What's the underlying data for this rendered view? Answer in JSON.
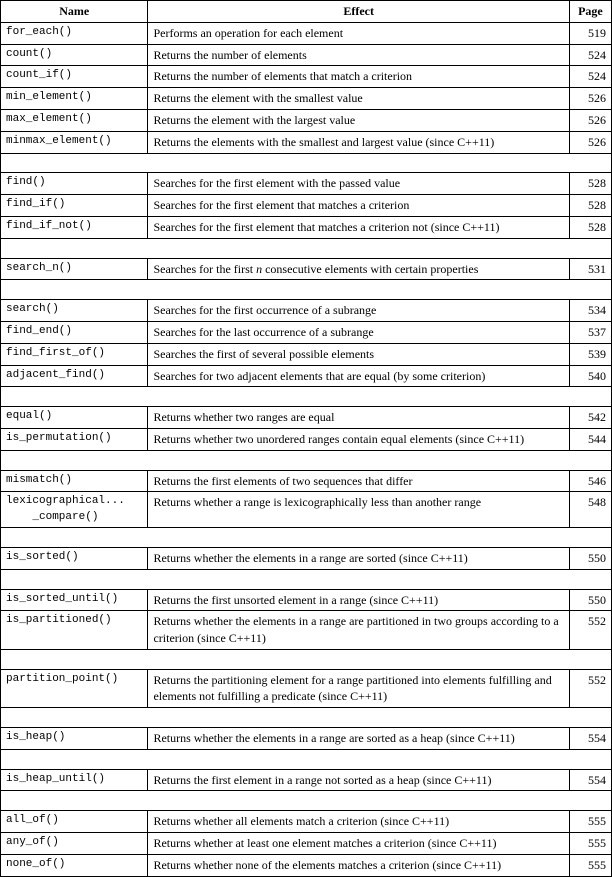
{
  "table": {
    "headers": {
      "name": "Name",
      "effect": "Effect",
      "page": "Page"
    },
    "rows": [
      {
        "name": "for_each()",
        "effect": "Performs an operation for each element",
        "page": "519",
        "empty_before": false
      },
      {
        "name": "count()",
        "effect": "Returns the number of elements",
        "page": "524",
        "empty_before": false
      },
      {
        "name": "count_if()",
        "effect": "Returns the number of elements that match a criterion",
        "page": "524",
        "empty_before": false
      },
      {
        "name": "min_element()",
        "effect": "Returns the element with the smallest value",
        "page": "526",
        "empty_before": false
      },
      {
        "name": "max_element()",
        "effect": "Returns the element with the largest value",
        "page": "526",
        "empty_before": false
      },
      {
        "name": "minmax_element()",
        "effect": "Returns the elements with the smallest and largest value (since C++11)",
        "page": "526",
        "empty_before": false
      },
      {
        "name": "",
        "effect": "",
        "page": "",
        "empty_before": true,
        "spacer": true
      },
      {
        "name": "find()",
        "effect": "Searches for the first element with the passed value",
        "page": "528",
        "empty_before": false
      },
      {
        "name": "find_if()",
        "effect": "Searches for the first element that matches a criterion",
        "page": "528",
        "empty_before": false
      },
      {
        "name": "find_if_not()",
        "effect": "Searches for the first element that matches a criterion not (since C++11)",
        "page": "528",
        "empty_before": false
      },
      {
        "name": "",
        "effect": "",
        "page": "",
        "empty_before": true,
        "spacer": true
      },
      {
        "name": "search_n()",
        "effect": "Searches for the first n consecutive elements with certain properties",
        "page": "531",
        "empty_before": false
      },
      {
        "name": "",
        "effect": "",
        "page": "",
        "empty_before": true,
        "spacer": true
      },
      {
        "name": "search()",
        "effect": "Searches for the first occurrence of a subrange",
        "page": "534",
        "empty_before": false
      },
      {
        "name": "find_end()",
        "effect": "Searches for the last occurrence of a subrange",
        "page": "537",
        "empty_before": false
      },
      {
        "name": "find_first_of()",
        "effect": "Searches the first of several possible elements",
        "page": "539",
        "empty_before": false
      },
      {
        "name": "adjacent_find()",
        "effect": "Searches for two adjacent elements that are equal (by some criterion)",
        "page": "540",
        "empty_before": false
      },
      {
        "name": "",
        "effect": "",
        "page": "",
        "empty_before": true,
        "spacer": true
      },
      {
        "name": "equal()",
        "effect": "Returns whether two ranges are equal",
        "page": "542",
        "empty_before": false
      },
      {
        "name": "is_permutation()",
        "effect": "Returns whether two unordered ranges contain equal elements (since C++11)",
        "page": "544",
        "empty_before": false
      },
      {
        "name": "",
        "effect": "",
        "page": "",
        "empty_before": true,
        "spacer": true
      },
      {
        "name": "mismatch()",
        "effect": "Returns the first elements of two sequences that differ",
        "page": "546",
        "empty_before": false
      },
      {
        "name": "lexicographical...\n    _compare()",
        "effect": "Returns whether a range is lexicographically less than another range",
        "page": "548",
        "empty_before": false
      },
      {
        "name": "",
        "effect": "",
        "page": "",
        "empty_before": true,
        "spacer": true
      },
      {
        "name": "is_sorted()",
        "effect": "Returns whether the elements in a range are sorted (since C++11)",
        "page": "550",
        "empty_before": false
      },
      {
        "name": "",
        "effect": "",
        "page": "",
        "empty_before": true,
        "spacer": true
      },
      {
        "name": "is_sorted_until()",
        "effect": "Returns the first unsorted element in a range (since C++11)",
        "page": "550",
        "empty_before": false
      },
      {
        "name": "is_partitioned()",
        "effect": "Returns whether the elements in a range are partitioned in two groups according to a criterion (since C++11)",
        "page": "552",
        "empty_before": false
      },
      {
        "name": "",
        "effect": "",
        "page": "",
        "empty_before": true,
        "spacer": true
      },
      {
        "name": "partition_point()",
        "effect": "Returns the partitioning element for a range partitioned into elements fulfilling and elements not fulfilling a predicate (since C++11)",
        "page": "552",
        "empty_before": false
      },
      {
        "name": "",
        "effect": "",
        "page": "",
        "empty_before": true,
        "spacer": true
      },
      {
        "name": "is_heap()",
        "effect": "Returns whether the elements in a range are sorted as a heap (since C++11)",
        "page": "554",
        "empty_before": false
      },
      {
        "name": "",
        "effect": "",
        "page": "",
        "empty_before": true,
        "spacer": true
      },
      {
        "name": "is_heap_until()",
        "effect": "Returns the first element in a range not sorted as a heap (since C++11)",
        "page": "554",
        "empty_before": false
      },
      {
        "name": "",
        "effect": "",
        "page": "",
        "empty_before": true,
        "spacer": true
      },
      {
        "name": "all_of()",
        "effect": "Returns whether all elements match a criterion (since C++11)",
        "page": "555",
        "empty_before": false
      },
      {
        "name": "any_of()",
        "effect": "Returns whether at least one element matches a criterion (since C++11)",
        "page": "555",
        "empty_before": false
      },
      {
        "name": "none_of()",
        "effect": "Returns whether none of the elements matches a criterion (since C++11)",
        "page": "555",
        "empty_before": false
      }
    ]
  }
}
